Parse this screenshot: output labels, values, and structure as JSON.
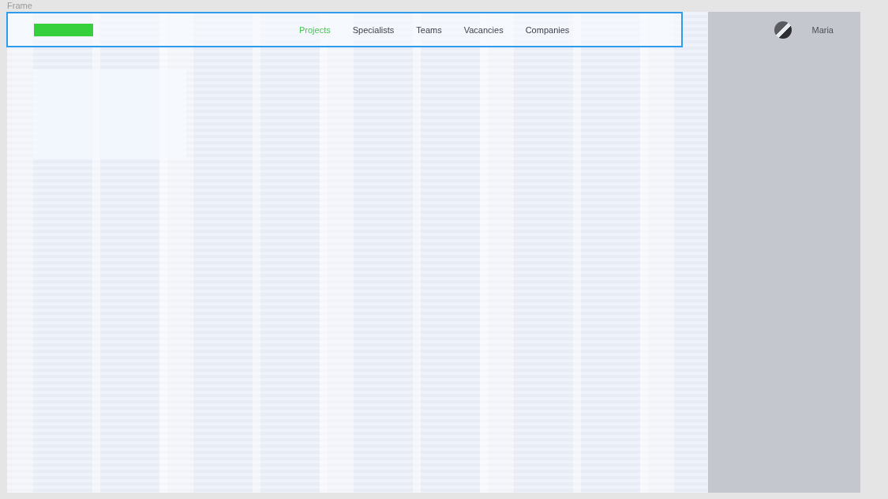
{
  "canvas_label": "Frame",
  "header": {
    "selected": true,
    "nav": [
      {
        "label": "Projects",
        "selected": true
      },
      {
        "label": "Specialists",
        "selected": false
      },
      {
        "label": "Teams",
        "selected": false
      },
      {
        "label": "Vacancies",
        "selected": false
      },
      {
        "label": "Companies",
        "selected": false
      }
    ]
  },
  "user": {
    "name": "Maria"
  }
}
